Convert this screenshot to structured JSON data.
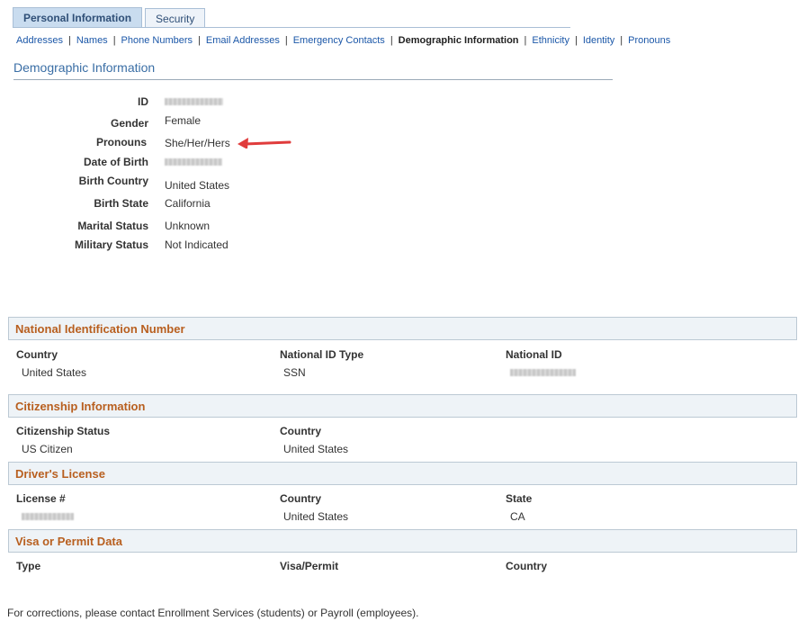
{
  "tabs": [
    {
      "label": "Personal Information",
      "active": true
    },
    {
      "label": "Security",
      "active": false
    }
  ],
  "subnav": {
    "addresses": "Addresses",
    "names": "Names",
    "phone_numbers": "Phone Numbers",
    "email_addresses": "Email Addresses",
    "emergency_contacts": "Emergency Contacts",
    "demographic_information": "Demographic Information",
    "ethnicity": "Ethnicity",
    "identity": "Identity",
    "pronouns": "Pronouns"
  },
  "page_title": "Demographic Information",
  "demographics": {
    "id_label": "ID",
    "gender_label": "Gender",
    "gender_value": "Female",
    "pronouns_label": "Pronouns",
    "pronouns_value": "She/Her/Hers",
    "dob_label": "Date of Birth",
    "birth_country_label": "Birth Country",
    "birth_country_value": "United States",
    "birth_state_label": "Birth State",
    "birth_state_value": "California",
    "marital_status_label": "Marital Status",
    "marital_status_value": "Unknown",
    "military_status_label": "Military Status",
    "military_status_value": "Not Indicated"
  },
  "national_id": {
    "header": "National Identification Number",
    "col_country": "Country",
    "col_type": "National ID Type",
    "col_id": "National ID",
    "country": "United States",
    "type": "SSN"
  },
  "citizenship": {
    "header": "Citizenship Information",
    "col_status": "Citizenship Status",
    "col_country": "Country",
    "status": "US Citizen",
    "country": "United States"
  },
  "drivers_license": {
    "header": "Driver's License",
    "col_license": "License #",
    "col_country": "Country",
    "col_state": "State",
    "country": "United States",
    "state": "CA"
  },
  "visa": {
    "header": "Visa or Permit Data",
    "col_type": "Type",
    "col_visa": "Visa/Permit",
    "col_country": "Country"
  },
  "footer": "For corrections, please contact Enrollment Services (students) or Payroll (employees).",
  "colors": {
    "accent_red_arrow": "#e03c3c",
    "section_header_text": "#b85f1f",
    "link_blue": "#1b57a8"
  }
}
